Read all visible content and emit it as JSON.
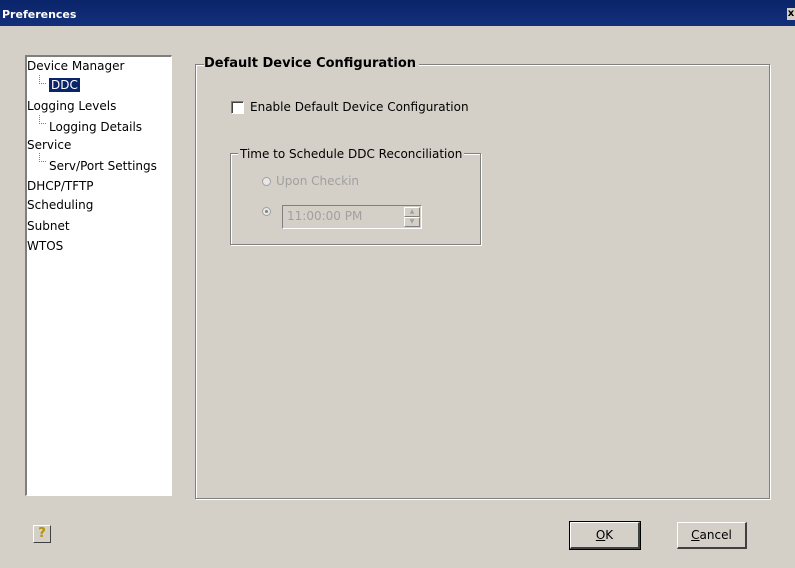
{
  "window": {
    "title": "Preferences",
    "close_glyph": "x"
  },
  "nav": {
    "items": [
      {
        "label": "Device Manager"
      },
      {
        "label": "DDC"
      },
      {
        "label": "Logging Levels"
      },
      {
        "label": "Logging Details"
      },
      {
        "label": "Service"
      },
      {
        "label": "Serv/Port Settings"
      },
      {
        "label": "DHCP/TFTP"
      },
      {
        "label": "Scheduling"
      },
      {
        "label": "Subnet"
      },
      {
        "label": "WTOS"
      }
    ]
  },
  "panel": {
    "title": "Default Device Configuration",
    "enable_label": "Enable Default Device Configuration",
    "enable_checked": false,
    "schedule": {
      "title": "Time to Schedule DDC Reconciliation",
      "option_checkin": "Upon Checkin",
      "time_value": "11:00:00 PM"
    }
  },
  "footer": {
    "help_label": "?",
    "ok_prefix": "",
    "ok_mnemonic": "O",
    "ok_rest": "K",
    "cancel_mnemonic": "C",
    "cancel_rest": "ancel"
  },
  "colors": {
    "title_bar": "#0a246a",
    "dialog_bg": "#d4d0c8",
    "selection": "#0a246a"
  }
}
